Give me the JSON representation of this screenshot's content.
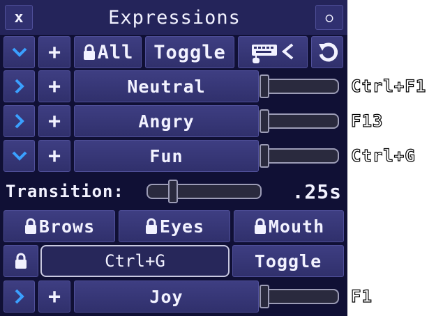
{
  "window": {
    "title": "Expressions",
    "close_label": "x",
    "collapse_label": "○"
  },
  "toolbar": {
    "expand_label": "⌄",
    "add_label": "+",
    "lock_all_label": "All",
    "toggle_label": "Toggle",
    "undo_label": "↻"
  },
  "expressions": [
    {
      "name": "Neutral",
      "expanded": false,
      "value": 0,
      "hotkey": "Ctrl+F1"
    },
    {
      "name": "Angry",
      "expanded": false,
      "value": 0,
      "hotkey": "F13"
    },
    {
      "name": "Fun",
      "expanded": true,
      "value": 0,
      "hotkey": "Ctrl+G"
    },
    {
      "name": "Joy",
      "expanded": false,
      "value": 0,
      "hotkey": "F1"
    }
  ],
  "fun_details": {
    "transition_label": "Transition:",
    "transition_value": ".25s",
    "locks": [
      "Brows",
      "Eyes",
      "Mouth"
    ],
    "keybind": "Ctrl+G",
    "toggle_label": "Toggle"
  },
  "colors": {
    "accent": "#3aa0ff",
    "panel": "#101035",
    "button": "#34346f",
    "title_bar": "#24245a"
  },
  "icons": [
    "close-icon",
    "chevron-down-icon",
    "chevron-right-icon",
    "plus-icon",
    "lock-icon",
    "keyboard-arrow-icon",
    "undo-icon"
  ]
}
